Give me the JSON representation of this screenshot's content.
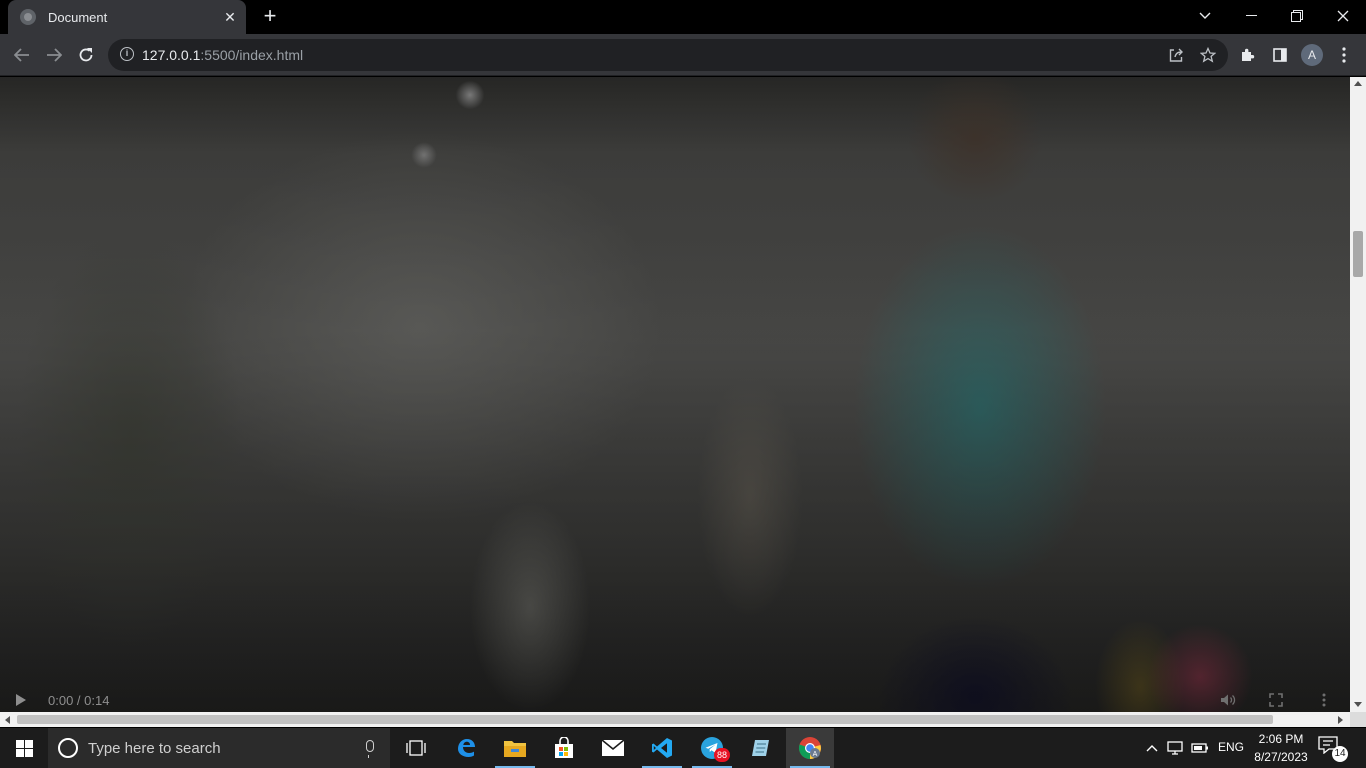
{
  "browser": {
    "tab_title": "Document",
    "url_host": "127.0.0.1",
    "url_rest": ":5500/index.html",
    "profile_initial": "A"
  },
  "video": {
    "time": "0:00 / 0:14"
  },
  "taskbar": {
    "search_placeholder": "Type here to search",
    "telegram_badge": "88",
    "language": "ENG",
    "time": "2:06 PM",
    "date": "8/27/2023",
    "notification_count": "14"
  }
}
